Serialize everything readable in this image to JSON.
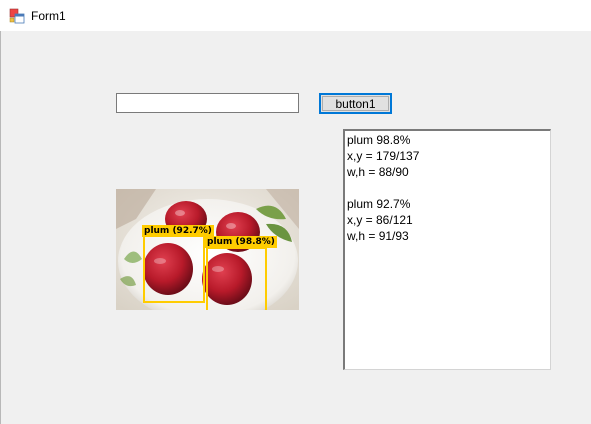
{
  "window": {
    "title": "Form1",
    "icon": "winforms-app-icon"
  },
  "input": {
    "value": "",
    "placeholder": ""
  },
  "button1": {
    "label": "button1"
  },
  "detections": [
    {
      "label": "plum (92.7%)"
    },
    {
      "label": "plum (98.8%)"
    }
  ],
  "output": {
    "lines": [
      "plum 98.8%",
      "x,y = 179/137",
      "w,h = 88/90",
      "",
      "plum 92.7%",
      "x,y = 86/121",
      "w,h = 91/93"
    ]
  },
  "colors": {
    "box": "#ffcc00",
    "button_focus": "#0078d7",
    "plum": "#c0202e"
  }
}
